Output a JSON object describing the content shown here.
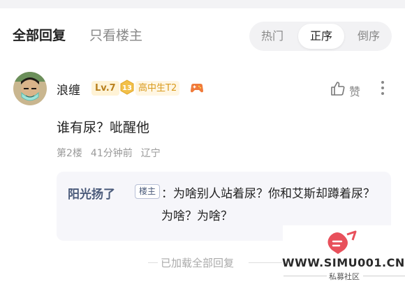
{
  "tabs": {
    "all_replies": "全部回复",
    "op_only": "只看楼主"
  },
  "sort": {
    "hot": "热门",
    "ascending": "正序",
    "descending": "倒序",
    "selected": "正序"
  },
  "comment": {
    "username": "浪缠",
    "level": "Lv.7",
    "badge_number": "13",
    "rank_title": "高中生T2",
    "text": "谁有尿？呲醒他",
    "floor": "第2楼",
    "time": "41分钟前",
    "location": "辽宁",
    "like_label": "赞"
  },
  "reply": {
    "author": "阳光扬了",
    "op_tag": "楼主",
    "text": "：为啥别人站着尿？你和艾斯却蹲着尿？为啥？为啥？"
  },
  "footer": {
    "loaded_all": "已加载全部回复"
  },
  "watermark": {
    "url": "WWW.SIMU001.CN",
    "subtitle": "私募社区"
  },
  "colors": {
    "accent_gold": "#d99b1f",
    "reply_author": "#4a5a7a",
    "muted": "#999999"
  },
  "icons": [
    "avatar",
    "lv-badge",
    "number-13-badge",
    "game-controller-icon",
    "thumbs-up-icon",
    "more-vertical-icon",
    "watermark-logo"
  ]
}
